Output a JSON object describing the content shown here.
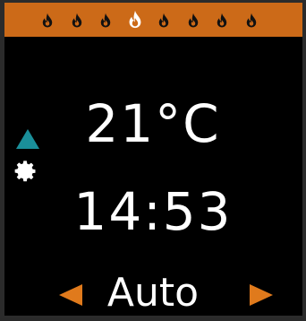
{
  "display": {
    "temperature": "21°C",
    "time": "14:53",
    "mode": "Auto"
  },
  "flame_bar": {
    "levels": 8,
    "active_level": 4,
    "color": "#cc6a18"
  },
  "icons": {
    "up": "triangle-up-icon",
    "settings": "gear-icon",
    "mode_prev": "arrow-left-icon",
    "mode_next": "arrow-right-icon",
    "flame": "flame-icon"
  },
  "colors": {
    "accent": "#e07a1c",
    "teal": "#1a8f9a",
    "screen_bg": "#000000",
    "text": "#ffffff"
  }
}
